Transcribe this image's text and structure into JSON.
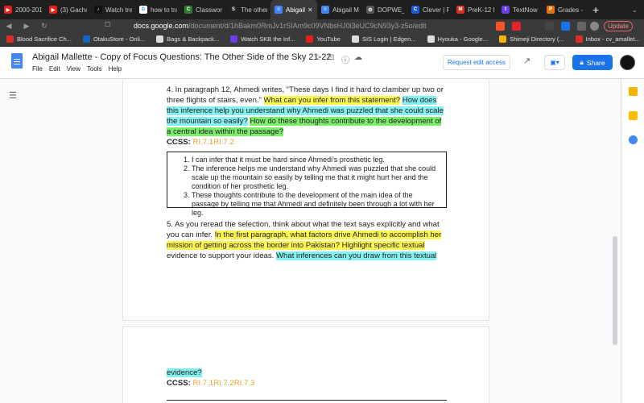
{
  "browser": {
    "tabs": [
      {
        "label": "2000-2010",
        "fav_color": "#e62117",
        "fav_char": "▶"
      },
      {
        "label": "(3) Gachal",
        "fav_color": "#e62117",
        "fav_char": "▶"
      },
      {
        "label": "Watch tren",
        "fav_color": "#111111",
        "fav_char": "♪"
      },
      {
        "label": "how to tran",
        "fav_color": "#ffffff",
        "fav_char": "G"
      },
      {
        "label": "Classwork",
        "fav_color": "#2e7d32",
        "fav_char": "C"
      },
      {
        "label": "The other s",
        "fav_color": "#222222",
        "fav_char": "S"
      },
      {
        "label": "Abigail",
        "fav_color": "#4285f4",
        "fav_char": "≡",
        "active": true
      },
      {
        "label": "Abigail Mal",
        "fav_color": "#4285f4",
        "fav_char": "≡"
      },
      {
        "label": "DOPWE_T(",
        "fav_color": "#555555",
        "fav_char": "⚙"
      },
      {
        "label": "Clever | Po",
        "fav_color": "#1e5bd8",
        "fav_char": "C"
      },
      {
        "label": "PreK-12 Le",
        "fav_color": "#d93025",
        "fav_char": "M"
      },
      {
        "label": "TextNow",
        "fav_color": "#6a3de8",
        "fav_char": "t"
      },
      {
        "label": "Grades - P",
        "fav_color": "#e8710a",
        "fav_char": "P"
      }
    ],
    "new_tab_glyph": "+",
    "url": {
      "host": "docs.google.com",
      "path": "/document/d/1hBakm0RmJv1rSIAm9c09VNbsHJ0i3eUC9cN93y3-z5o/edit"
    },
    "update_label": "Update",
    "bookmarks": [
      {
        "label": "Blood Sacrifice Ch...",
        "color": "#d93025"
      },
      {
        "label": "OtakuStore - Onli...",
        "color": "#1565c0"
      },
      {
        "label": "Bags & Backpack...",
        "color": "#dddddd"
      },
      {
        "label": "Watch SKB the Inf...",
        "color": "#6a3de8"
      },
      {
        "label": "YouTube",
        "color": "#e62117"
      },
      {
        "label": "SIS Login | Edgen...",
        "color": "#dddddd"
      },
      {
        "label": "Hyouka - Google...",
        "color": "#dddddd"
      },
      {
        "label": "Shimeji Directory (...",
        "color": "#f4b400"
      },
      {
        "label": "Inbox - cv_amallet...",
        "color": "#d93025"
      }
    ],
    "bookmarks_more": "»"
  },
  "docs": {
    "title": "Abigail Mallette - Copy of Focus Questions: The Other Side of the Sky 21-22",
    "menu": [
      "File",
      "Edit",
      "View",
      "Tools",
      "Help"
    ],
    "request_edit_label": "Request edit access",
    "share_label": "Share",
    "colors": {
      "accent": "#1a73e8",
      "highlight_yellow": "#fdf651",
      "highlight_cyan": "#85f0f0",
      "highlight_green": "#7bee6a",
      "standard_orange": "#e3a035"
    }
  },
  "document": {
    "q4": {
      "intro": "4. In paragraph 12, Ahmedi writes, “These days I find it hard to clamber up two or three flights of stairs, even.” ",
      "hl_yellow": "What can you infer from this statement?",
      "hl_cyan": "How does this inference help you understand why Ahmedi was puzzled that she could scale the mountain so easily?",
      "hl_green": "How do these thoughts contribute to the development of a central idea within the passage?",
      "ccss_label": "CCSS:",
      "ccss_value": "RI.7.1RI.7.2"
    },
    "answers": [
      "I can infer that it must be hard since Ahmedi's prosthetic leg.",
      "The inference helps me understand why Ahmedi was puzzled that she could scale up the mountain so easily by telling me that it might hurt her and the condition of her prosthetic leg.",
      "These thoughts contribute to the development of the main idea of the passage by telling me that Ahmedi and definitely been through a lot with her leg."
    ],
    "q5": {
      "intro": "5. As you reread the selection, think about what the text says explicitly and what you can infer. ",
      "hl_yellow": "In the first paragraph, what factors drive Ahmedi to accomplish her mission of getting across the border into Pakistan? Highlight specific textual",
      "plain": " evidence to support your ideas. ",
      "hl_cyan": "What inferences can you draw from this textual",
      "hl_cyan_cont": "evidence?",
      "ccss_label": "CCSS:",
      "ccss_value": "RI.7.1RI.7.2RI.7.3"
    }
  }
}
